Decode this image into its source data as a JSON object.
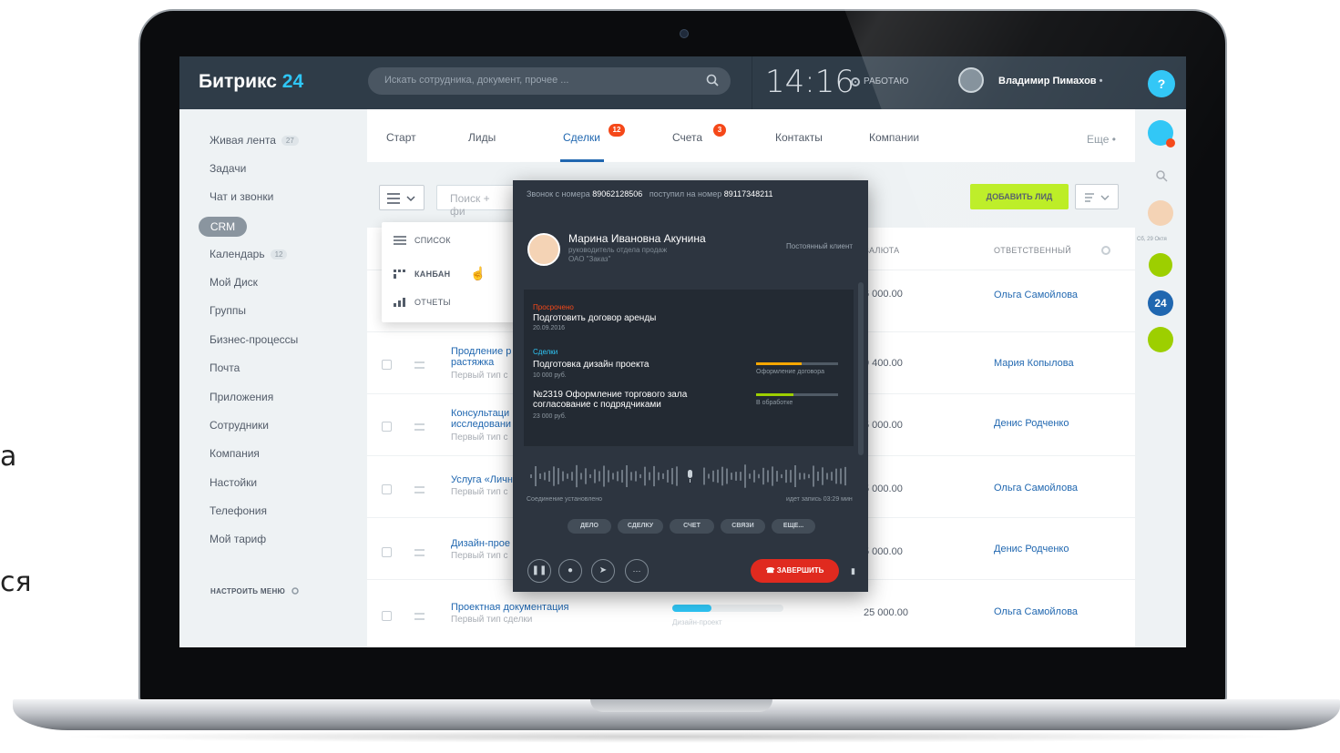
{
  "side_text": {
    "line1": "а",
    "line2": "ся"
  },
  "topbar": {
    "logo_main": "Битрикс",
    "logo_num": "24",
    "search_placeholder": "Искать сотрудника, документ, прочее ...",
    "time": "14:16",
    "status": "РАБОТАЮ",
    "user_name": "Владимир Пимахов",
    "help": "?"
  },
  "sidebar": {
    "items": [
      {
        "label": "Живая лента",
        "badge": "27"
      },
      {
        "label": "Задачи"
      },
      {
        "label": "Чат и звонки"
      },
      {
        "label": "CRM"
      },
      {
        "label": "Календарь",
        "badge": "12"
      },
      {
        "label": "Мой Диск"
      },
      {
        "label": "Группы"
      },
      {
        "label": "Бизнес-процессы"
      },
      {
        "label": "Почта"
      },
      {
        "label": "Приложения"
      },
      {
        "label": "Сотрудники"
      },
      {
        "label": "Компания"
      },
      {
        "label": "Настойки"
      },
      {
        "label": "Телефония"
      },
      {
        "label": "Мой тариф"
      }
    ],
    "setup": "НАСТРОИТЬ МЕНЮ"
  },
  "tabs": {
    "items": [
      {
        "label": "Старт"
      },
      {
        "label": "Лиды"
      },
      {
        "label": "Сделки",
        "badge": "12"
      },
      {
        "label": "Счета",
        "badge": "3"
      },
      {
        "label": "Контакты"
      },
      {
        "label": "Компании"
      }
    ],
    "more": "Еще"
  },
  "toolbar": {
    "filter_placeholder": "Поиск + фи",
    "add_button": "ДОБАВИТЬ ЛИД"
  },
  "view_menu": {
    "items": [
      "СПИСОК",
      "КАНБАН",
      "ОТЧЕТЫ"
    ]
  },
  "table": {
    "headers": {
      "currency": "ВАЛЮТА",
      "responsible": "ОТВЕТСТВЕННЫЙ"
    },
    "rows": [
      {
        "title": "",
        "sub": "",
        "amount": "6 000.00",
        "resp": "Ольга Самойлова"
      },
      {
        "title": "Продление р\nрастяжка",
        "sub": "Первый тип с",
        "amount": "9 400.00",
        "resp": "Мария Копылова"
      },
      {
        "title": "Консультаци\nисследовани",
        "sub": "Первый тип с",
        "amount": "5 000.00",
        "resp": "Денис Родченко"
      },
      {
        "title": "Услуга «Личн",
        "sub": "Первый тип с",
        "amount": "5 000.00",
        "resp": "Ольга Самойлова"
      },
      {
        "title": "Дизайн-прое",
        "sub": "Первый тип с",
        "amount": "5 000.00",
        "resp": "Денис Родченко"
      },
      {
        "title": "Проектная документация",
        "sub": "Первый тип сделки",
        "amount": "25 000.00",
        "resp": "Ольга Самойлова",
        "stage": "Дизайн-проект",
        "progress": 0.35
      }
    ]
  },
  "call": {
    "from_label": "Звонок с номера",
    "from_number": "89062128506",
    "to_label": "поступил на номер",
    "to_number": "89117348211",
    "client_name": "Марина Ивановна Акунина",
    "client_role": "руководитель отдела продаж",
    "client_company": "ОАО \"Заказ\"",
    "client_tag": "Постоянный клиент",
    "overdue_label": "Просрочено",
    "overdue_task": "Подготовить договор аренды",
    "overdue_date": "20.09.2016",
    "deals_label": "Сделки",
    "deal1_title": "Подготовка дизайн проекта",
    "deal1_sum": "10 000 руб.",
    "deal1_stage": "Оформление договора",
    "deal1_progress": 0.55,
    "deal2_title": "№2319 Оформление торгового зала согласование с подрядчиками",
    "deal2_sum": "23 000 руб.",
    "deal2_stage": "В обработке",
    "deal2_progress": 0.45,
    "connected": "Соединение установлено",
    "recording": "идет запись 03:29 мин",
    "chips": [
      "ДЕЛО",
      "СДЕЛКУ",
      "СЧЕТ",
      "СВЯЗИ",
      "ЕЩЕ..."
    ],
    "end_button": "ЗАВЕРШИТЬ"
  },
  "rightbar": {
    "date": "Сб, 29 Октя"
  },
  "colors": {
    "accent": "#2fc6f6",
    "add_button": "#bbed21",
    "end_call": "#e02a1f",
    "badge": "#f54819",
    "link": "#2067b0"
  }
}
